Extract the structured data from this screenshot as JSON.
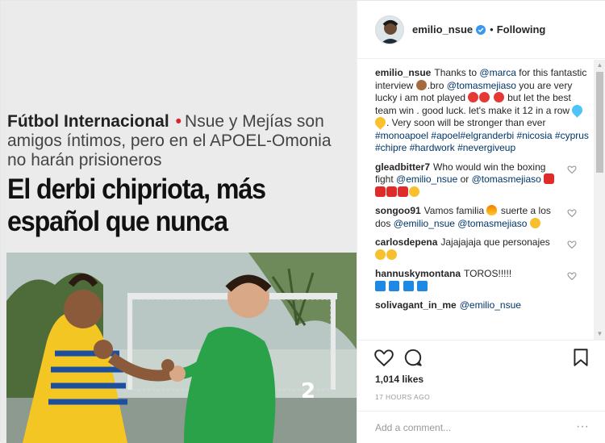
{
  "media": {
    "kicker": "Fútbol Internacional",
    "dot": "•",
    "subtitle": "Nsue y Mejías son amigos íntimos, pero en el APOEL-Omonia no harán prisioneros",
    "title": "El derbi chipriota, más español que nunca"
  },
  "header": {
    "username": "emilio_nsue",
    "separator": "•",
    "follow_label": "Following"
  },
  "caption": {
    "username": "emilio_nsue",
    "t1": "Thanks to",
    "m1": "@marca",
    "t2": "for this fantastic interview",
    "t3": ".bro",
    "m2": "@tomasmejiaso",
    "t4": "you are very lucky i am not played",
    "t5": "but let the best team win . good luck. let's make it 12 in a row",
    "t6": ". Very soon will be stronger than ever",
    "tags": [
      "#monoapoel",
      "#apoel",
      "#elgranderbi",
      "#nicosia",
      "#cyprus",
      "#chipre",
      "#hardwork",
      "#nevergiveup"
    ]
  },
  "comments": [
    {
      "username": "gleadbitter7",
      "text": "Who would win the boxing fight",
      "m1": "@emilio_nsue",
      "t2": "or",
      "m2": "@tomasmejiaso"
    },
    {
      "username": "songoo91",
      "text": "Vamos familia",
      "t2": "suerte a los dos",
      "m1": "@emilio_nsue",
      "m2": "@tomasmejiaso"
    },
    {
      "username": "carlosdepena",
      "text": "Jajajajaja que personajes"
    },
    {
      "username": "hannuskymontana",
      "text": "TOROS!!!!!"
    },
    {
      "username": "solivagant_in_me",
      "m1": "@emilio_nsue"
    }
  ],
  "likes": "1,014 likes",
  "time_ago": "17 HOURS AGO",
  "add_comment": {
    "placeholder": "Add a comment..."
  },
  "more_label": "···",
  "icons": {
    "like": "heart-icon",
    "comment": "comment-icon",
    "save": "bookmark-icon",
    "verified": "verified-badge-icon"
  },
  "colors": {
    "link": "#003569",
    "verified": "#3897f0",
    "text": "#262626",
    "muted": "#999999"
  }
}
